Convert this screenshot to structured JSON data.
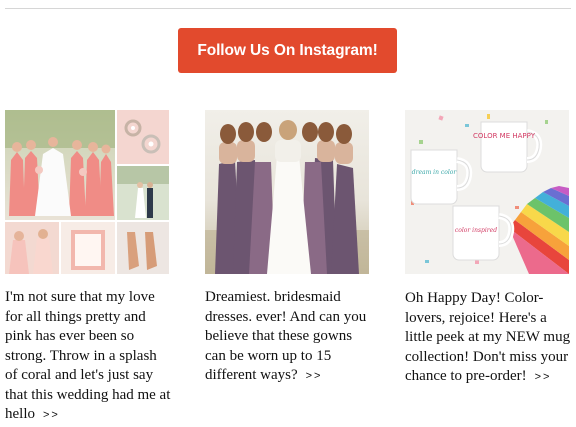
{
  "cta": {
    "label": "Follow Us On Instagram!"
  },
  "posts": [
    {
      "caption": "I'm not sure that my love for all things pretty and pink has ever been so strong. Throw in a splash of coral and let's just say that this wedding had me at hello",
      "more_label": ">>"
    },
    {
      "caption": "Dreamiest. bridesmaid dresses. ever! And can you believe that these gowns can be worn up to 15 different ways?",
      "more_label": ">>"
    },
    {
      "caption": "Oh Happy Day! Color-lovers, rejoice! Here's a little peek at my NEW mug collection! Don't miss your chance to pre-order!",
      "more_label": ">>"
    }
  ],
  "mug_texts": {
    "mug1": "COLOR ME HAPPY",
    "mug2": "dream in color",
    "mug3": "color inspired"
  },
  "colors": {
    "accent": "#e24a2d",
    "accent_text": "#ffffff",
    "rule": "#d6d6d6"
  }
}
